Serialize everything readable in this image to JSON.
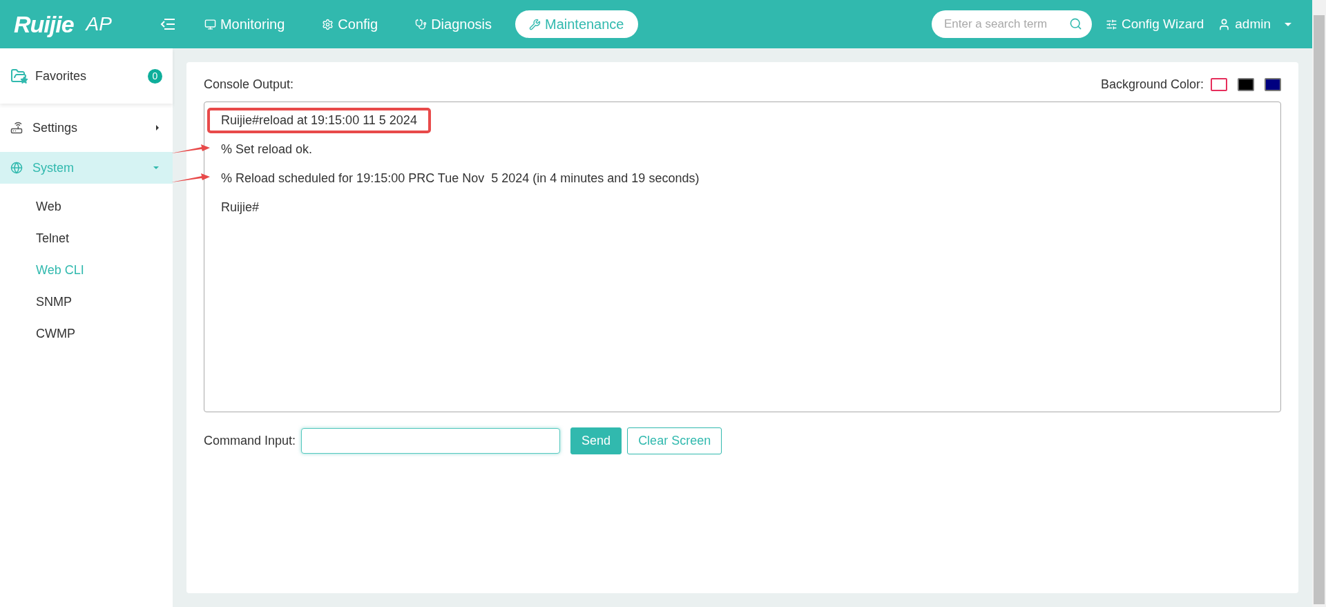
{
  "header": {
    "logo": "Ruijie",
    "product": "AP",
    "nav": [
      {
        "label": "Monitoring",
        "selected": false
      },
      {
        "label": "Config",
        "selected": false
      },
      {
        "label": "Diagnosis",
        "selected": false
      },
      {
        "label": "Maintenance",
        "selected": true
      }
    ],
    "search": {
      "placeholder": "Enter a search term"
    },
    "wizard": "Config Wizard",
    "user": "admin"
  },
  "sidebar": {
    "favorites": {
      "label": "Favorites",
      "count": "0"
    },
    "items": [
      {
        "label": "Settings",
        "expanded": false,
        "selected": false
      },
      {
        "label": "System",
        "expanded": true,
        "selected": true,
        "children": [
          {
            "label": "Web",
            "selected": false
          },
          {
            "label": "Telnet",
            "selected": false
          },
          {
            "label": "Web CLI",
            "selected": true
          },
          {
            "label": "SNMP",
            "selected": false
          },
          {
            "label": "CWMP",
            "selected": false
          }
        ]
      }
    ]
  },
  "console": {
    "title": "Console Output:",
    "background_label": "Background Color:",
    "background_colors": [
      {
        "color": "#ffffff",
        "selected": true
      },
      {
        "color": "#000000",
        "selected": false
      },
      {
        "color": "#000080",
        "selected": false
      }
    ],
    "lines": [
      {
        "text": "Ruijie#reload at 19:15:00 11 5 2024",
        "highlighted": true,
        "arrow": false
      },
      {
        "text": "% Set reload ok.",
        "highlighted": false,
        "arrow": true
      },
      {
        "text": "% Reload scheduled for 19:15:00 PRC Tue Nov  5 2024 (in 4 minutes and 19 seconds)",
        "highlighted": false,
        "arrow": true
      },
      {
        "text": "Ruijie#",
        "highlighted": false,
        "arrow": false
      }
    ],
    "command_label": "Command Input:",
    "buttons": [
      {
        "label": "Send",
        "kind": "primary"
      },
      {
        "label": "Clear Screen",
        "kind": "outline"
      }
    ]
  }
}
